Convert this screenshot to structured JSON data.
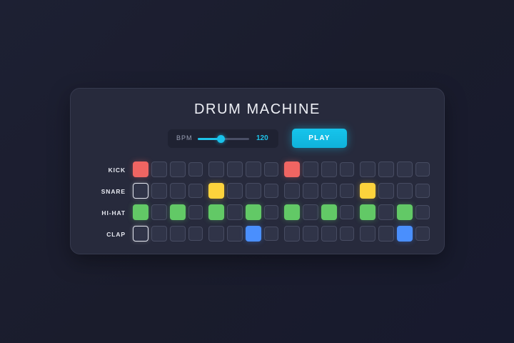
{
  "title": "DRUM MACHINE",
  "bpm": {
    "label": "BPM",
    "value": "120",
    "slider_fraction": 0.44
  },
  "play_button": {
    "label": "PLAY"
  },
  "current_step": 0,
  "colors": {
    "accent": "#16c4ec",
    "kick": "#f06562",
    "snare": "#fdd33c",
    "hihat": "#62c966",
    "clap": "#4a8ffd"
  },
  "tracks": [
    {
      "name": "KICK",
      "color": "#f06562",
      "steps": [
        1,
        0,
        0,
        0,
        0,
        0,
        0,
        0,
        1,
        0,
        0,
        0,
        0,
        0,
        0,
        0
      ]
    },
    {
      "name": "SNARE",
      "color": "#fdd33c",
      "steps": [
        0,
        0,
        0,
        0,
        1,
        0,
        0,
        0,
        0,
        0,
        0,
        0,
        1,
        0,
        0,
        0
      ]
    },
    {
      "name": "HI-HAT",
      "color": "#62c966",
      "steps": [
        1,
        0,
        1,
        0,
        1,
        0,
        1,
        0,
        1,
        0,
        1,
        0,
        1,
        0,
        1,
        0
      ]
    },
    {
      "name": "CLAP",
      "color": "#4a8ffd",
      "steps": [
        0,
        0,
        0,
        0,
        0,
        0,
        1,
        0,
        0,
        0,
        0,
        0,
        0,
        0,
        1,
        0
      ]
    }
  ]
}
